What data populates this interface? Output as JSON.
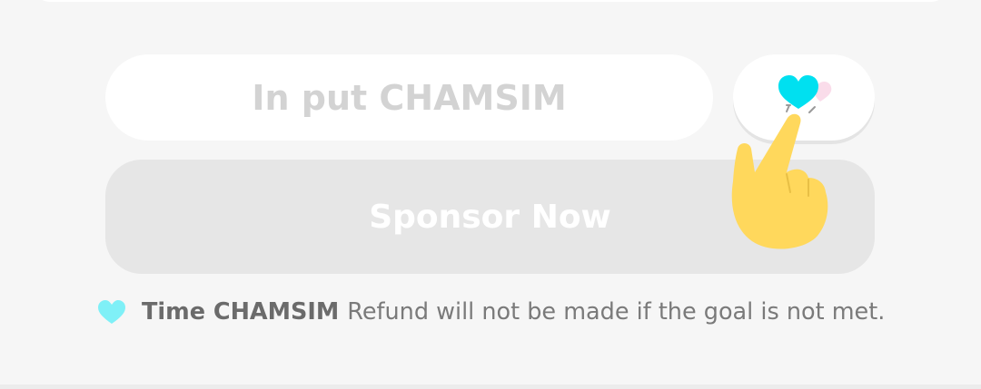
{
  "form": {
    "input_placeholder": "In put CHAMSIM",
    "input_value": "",
    "sponsor_label": "Sponsor Now"
  },
  "notice": {
    "label_bold": "Time CHAMSIM",
    "text": "Refund will not be made if the goal is not met."
  },
  "icons": {
    "heart_button_icon": "heart-icon",
    "notice_icon": "heart-icon",
    "overlay": "pointing-hand-icon"
  },
  "colors": {
    "background": "#f6f6f6",
    "heart_primary": "#00e0f0",
    "heart_secondary": "#fadcea",
    "notice_heart": "#7ff0f7",
    "hand": "#ffd85c",
    "sponsor_button": "#e6e6e6"
  }
}
